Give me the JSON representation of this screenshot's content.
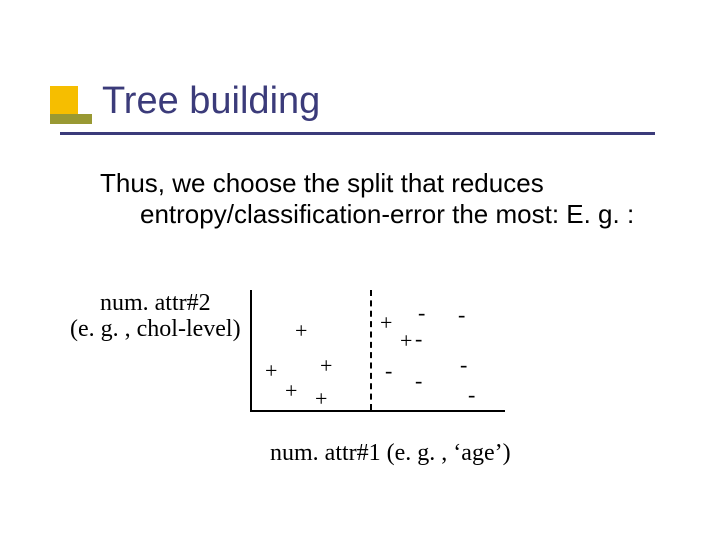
{
  "title": "Tree building",
  "body_line1": "Thus, we choose the split that reduces",
  "body_line2": "entropy/classification-error the most: E. g. :",
  "ylabel_line1": "num. attr#2",
  "ylabel_line2": "(e. g. , chol-level)",
  "xlabel": "num. attr#1 (e. g. , ‘age’)",
  "points": {
    "p1": "+",
    "p2": "+",
    "p3": "+",
    "p4": "+",
    "p5": "+",
    "p6": "+",
    "p7": "+",
    "m1": "-",
    "m2": "-",
    "m3": "-",
    "m4": "-",
    "m5": "-",
    "m6": "-",
    "m7": "-"
  }
}
